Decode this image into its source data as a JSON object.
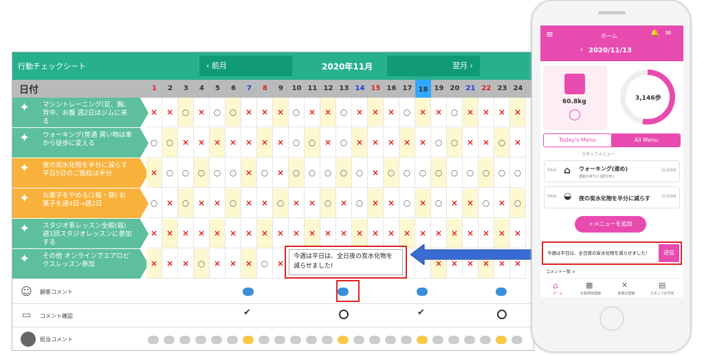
{
  "sheet": {
    "title": "行動チェックシート",
    "prev": "‹ 前月",
    "month": "2020年11月",
    "next": "翌月 ›",
    "date_label": "日付"
  },
  "days": [
    "1",
    "2",
    "3",
    "4",
    "5",
    "6",
    "7",
    "8",
    "9",
    "10",
    "11",
    "12",
    "13",
    "14",
    "15",
    "16",
    "17",
    "18",
    "19",
    "20",
    "21",
    "22",
    "23",
    "24"
  ],
  "day_colors": {
    "sat": "#1a3fd6",
    "sun": "#e02020",
    "today": "#33a8ff"
  },
  "activities": [
    {
      "label": "マシントレーニング(足、胸、背中、お腹 週2日はジムに来る",
      "color": "#5dbf9c",
      "marks": "x x o x o o x x x o x x o x x x o x x o x x x x"
    },
    {
      "label": "ウォーキング(普通 買い物は車から徒歩に変える",
      "color": "#5dbf9c",
      "marks": "o o x x x x x x x o o x o x x x x x o o x x o x"
    },
    {
      "label": "夜の炭水化物を半分に減らす 平日5日のご飯粒は半分",
      "color": "#f8b13a",
      "marks": "x o o o o o x o x o o o o o x o o o o o o o o o"
    },
    {
      "label": "お菓子をやめる(1箱・袋) お菓子を週4日→週2日",
      "color": "#f8b13a",
      "marks": "o x o x x o x x o x x o x o x x o x o x x o x o"
    },
    {
      "label": "スタジオ系レッスン全般(弱) 週1回スタジオレッスンに参加する",
      "color": "#5dbf9c",
      "marks": "x x x x x x x x x x x x x x x x x x x x x x x x"
    },
    {
      "label": "その他 オンラインでエアロビクスレッスン参加",
      "color": "#5dbf9c",
      "marks": "x x x o x x x o x - - - - - - - - - x x x x x x"
    }
  ],
  "lower_rows": {
    "client_comment": "顧客コメント",
    "comment_check": "コメント確認",
    "staff_comment": "担当コメント"
  },
  "callout_text": "今週は平日は、全日夜の炭水化物を減らせました!",
  "phone": {
    "header_title": "ホーム",
    "date": "2020/11/13",
    "weight": "60.8kg",
    "steps": "3,146歩",
    "tab_today": "Today's Menu",
    "tab_all": "All Menu",
    "staff_menu": "スタッフメニュー",
    "menu1_title": "ウォーキング(速め)",
    "menu1_sub": "通勤の帰りに1駅分歩く",
    "menu2_title": "夜の炭水化物を半分に減らす",
    "clear": "CLEAR",
    "fail": "FAIL",
    "add_menu": "メニューを追加",
    "input_value": "今週は平日は、全日夜の炭水化物を減らせました!",
    "send": "送信",
    "comment_list": "コメント一覧 >",
    "nav": [
      "ホーム",
      "計測項目登録",
      "食事の登録",
      "スタッフの予定"
    ]
  },
  "colors": {
    "pink": "#e84bb0",
    "green": "#26b08e",
    "orange": "#f8b13a",
    "red": "#e02020"
  }
}
